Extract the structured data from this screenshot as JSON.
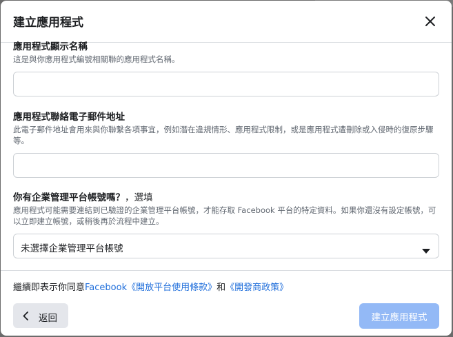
{
  "dialog": {
    "title": "建立應用程式",
    "close_icon": "close-icon"
  },
  "fields": {
    "display_name": {
      "label": "應用程式顯示名稱",
      "help": "這是與你應用程式編號相關聯的應用程式名稱。",
      "value": "",
      "placeholder": ""
    },
    "contact_email": {
      "label": "應用程式聯絡電子郵件地址",
      "help": "此電子郵件地址會用來與你聯繫各項事宜，例如潛在違規情形、應用程式限制，或是應用程式遭刪除或入侵時的復原步驟等。",
      "value": "",
      "placeholder": ""
    },
    "business_account": {
      "label": "你有企業管理平台帳號嗎？",
      "optional": "，選填",
      "help": "應用程式可能需要連結到已驗證的企業管理平台帳號，才能存取 Facebook 平台的特定資料。如果你還沒有設定帳號，可以立即建立帳號，或稍後再於流程中建立。",
      "selected": "未選擇企業管理平台帳號"
    }
  },
  "footer": {
    "terms_prefix": "繼續即表示你同意",
    "terms_link": "Facebook《開放平台使用條款》",
    "terms_and": "和",
    "policy_link": "《開發商政策》",
    "back_label": "返回",
    "create_label": "建立應用程式"
  },
  "colors": {
    "link": "#216fdb",
    "primary_disabled": "#93b9f6",
    "secondary_bg": "#e4e6eb"
  }
}
